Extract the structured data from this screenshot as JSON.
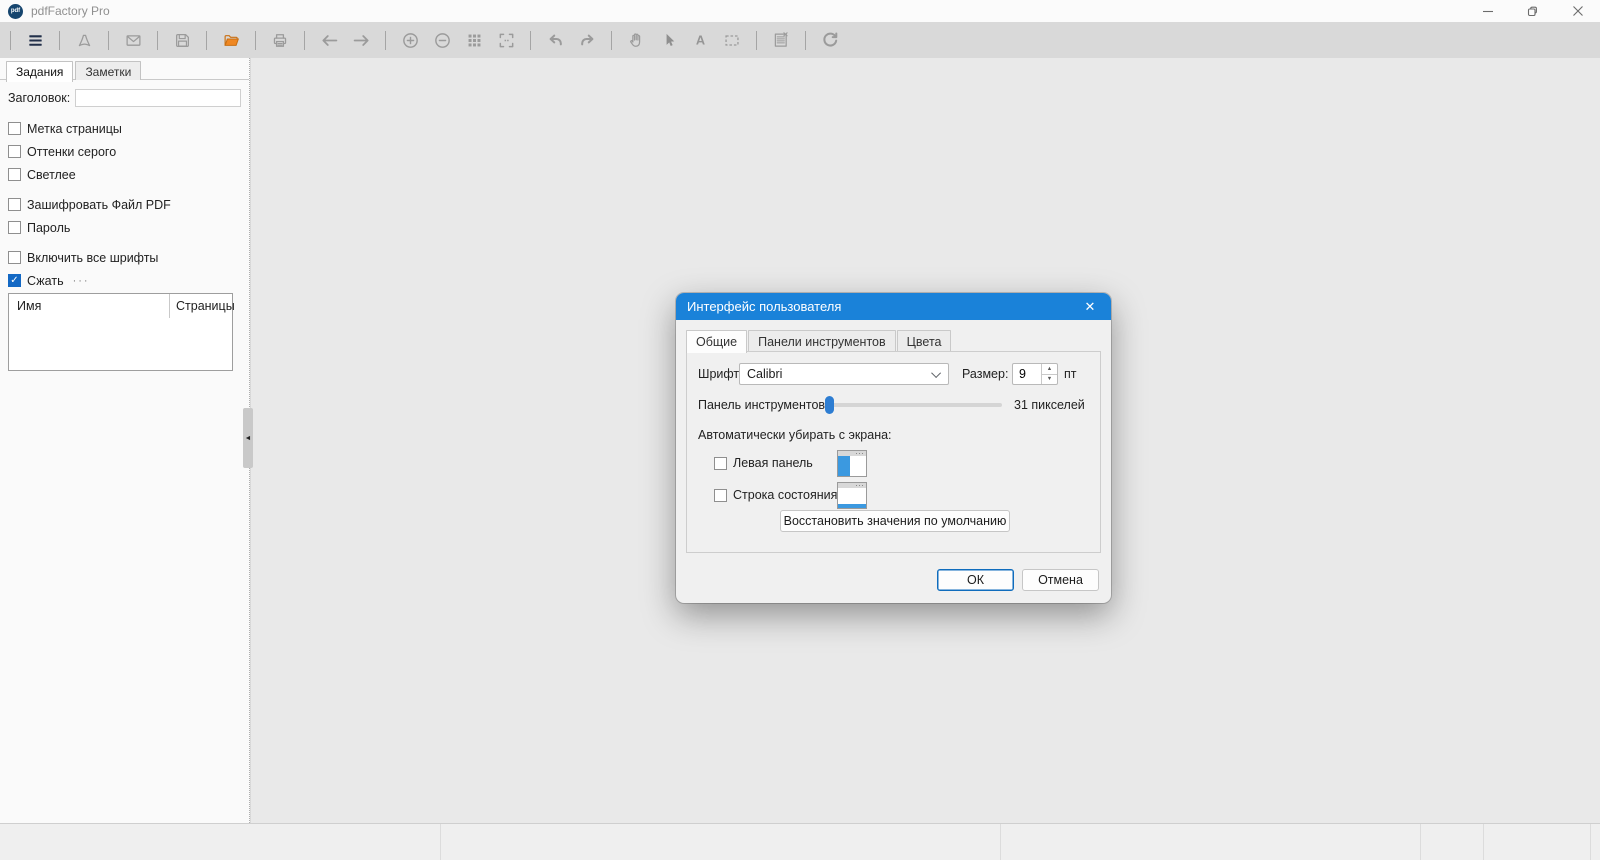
{
  "window": {
    "title": "pdfFactory Pro",
    "logo_text": "pdf"
  },
  "toolbar": {
    "groups": [
      [
        "menu"
      ],
      [
        "adobe-pdf"
      ],
      [
        "email"
      ],
      [
        "save"
      ],
      [
        "open-folder"
      ],
      [
        "print"
      ],
      [
        "back",
        "forward"
      ],
      [
        "zoom-in",
        "zoom-out",
        "grid-view",
        "fit-page"
      ],
      [
        "undo",
        "redo"
      ],
      [
        "pan-hand",
        "cursor",
        "text",
        "select"
      ],
      [
        "notes"
      ],
      [
        "refresh"
      ]
    ]
  },
  "sidebar": {
    "tabs": [
      {
        "label": "Задания",
        "active": true
      },
      {
        "label": "Заметки",
        "active": false
      }
    ],
    "title_field": {
      "label": "Заголовок:",
      "value": ""
    },
    "checkboxes": [
      {
        "label": "Метка страницы",
        "checked": false,
        "gap": false
      },
      {
        "label": "Оттенки серого",
        "checked": false,
        "gap": false
      },
      {
        "label": "Светлее",
        "checked": false,
        "gap": false
      },
      {
        "label": "Зашифровать Файл PDF",
        "checked": false,
        "gap": true
      },
      {
        "label": "Пароль",
        "checked": false,
        "gap": false
      },
      {
        "label": "Включить все шрифты",
        "checked": false,
        "gap": true
      },
      {
        "label": "Сжать",
        "checked": true,
        "gap": false,
        "suffix": "···"
      }
    ],
    "jobs_table": {
      "columns": [
        "Имя",
        "Страницы"
      ],
      "rows": []
    }
  },
  "dialog": {
    "title": "Интерфейс пользователя",
    "close_icon": "✕",
    "tabs": [
      {
        "label": "Общие",
        "active": true
      },
      {
        "label": "Панели инструментов",
        "active": false
      },
      {
        "label": "Цвета",
        "active": false
      }
    ],
    "font_row": {
      "label": "Шрифт:",
      "value": "Calibri",
      "size_label": "Размер:",
      "size_value": "9",
      "unit": "пт"
    },
    "toolbar_row": {
      "label": "Панель инструментов:",
      "value_text": "31 пикселей",
      "slider_percent": 3
    },
    "autohide": {
      "heading": "Автоматически убирать с экрана:",
      "options": [
        {
          "label": "Левая панель",
          "checked": false,
          "icon": "left-panel-preview-icon"
        },
        {
          "label": "Строка состояния",
          "checked": false,
          "icon": "status-bar-preview-icon"
        }
      ]
    },
    "restore_defaults_label": "Восстановить значения по умолчанию",
    "ok_label": "ОК",
    "cancel_label": "Отмена"
  },
  "colors": {
    "accent_blue": "#1a82d9",
    "checkbox_blue": "#1368c4",
    "slider_blue": "#2d7dd2",
    "folder_orange": "#ef8722",
    "preview_blue": "#3b99e0"
  }
}
